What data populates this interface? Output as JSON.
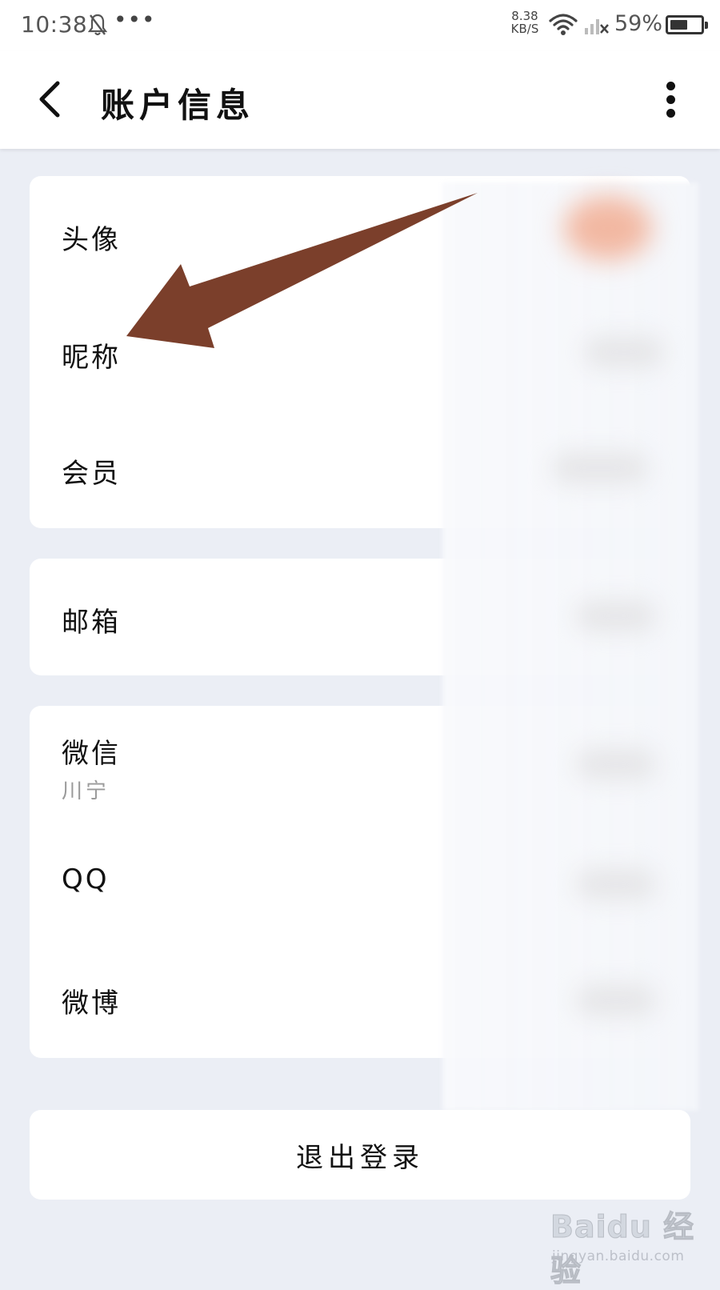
{
  "status_bar": {
    "time": "10:38",
    "dots": "•••",
    "net_speed_value": "8.38",
    "net_speed_unit": "KB/S",
    "battery_percent": "59%",
    "battery_level": 0.59
  },
  "header": {
    "title": "账户信息"
  },
  "account_card": {
    "rows": [
      {
        "label": "头像"
      },
      {
        "label": "昵称"
      },
      {
        "label": "会员"
      }
    ]
  },
  "email_card": {
    "label": "邮箱"
  },
  "social_card": {
    "wechat_label": "微信",
    "wechat_sub": "川宁",
    "qq_label": "QQ",
    "weibo_label": "微博"
  },
  "logout_label": "退出登录",
  "annotation_arrow_color": "#7b3f2b",
  "watermark": {
    "logo": "Baidu 经验",
    "url": "jingyan.baidu.com"
  }
}
